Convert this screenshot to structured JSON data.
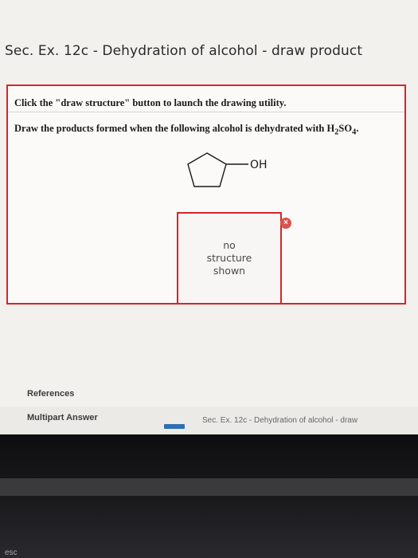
{
  "header": {
    "title": "Sec. Ex. 12c - Dehydration of alcohol - draw product"
  },
  "question": {
    "instruction_1": "Click the \"draw structure\" button to launch the drawing utility.",
    "instruction_2_prefix": "Draw the products formed when the following alcohol is dehydrated with H",
    "sub_2": "2",
    "mid_so": "SO",
    "sub_4": "4",
    "suffix": ".",
    "molecule_label": "OH",
    "placeholder": "no\nstructure\nshown",
    "remove_symbol": "×"
  },
  "footer": {
    "references": "References",
    "multipart": "Multipart Answer",
    "breadcrumb": "Sec. Ex. 12c - Dehydration of alcohol - draw"
  },
  "colors": {
    "accent_red": "#d8232a",
    "remove_button": "#d9534f",
    "nav_blue": "#2f6fb3"
  },
  "keyboard": {
    "key_label": "esc"
  }
}
